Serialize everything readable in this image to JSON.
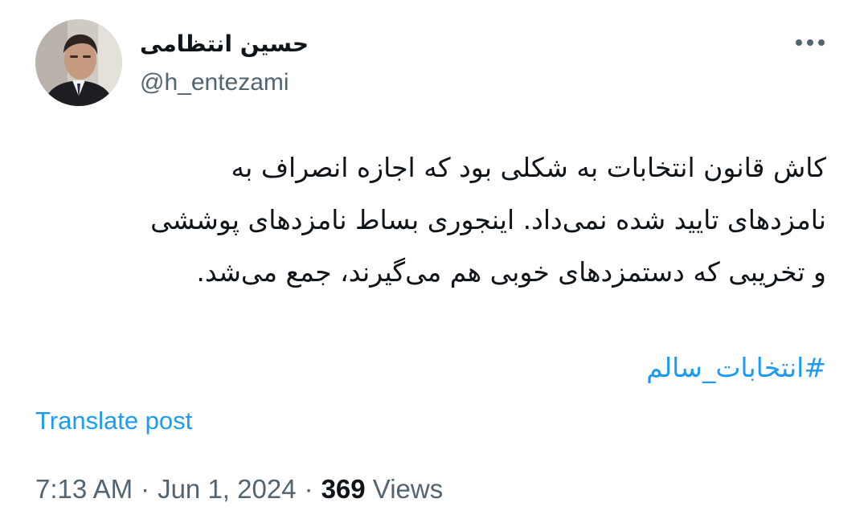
{
  "author": {
    "display_name": "حسین انتظامی",
    "handle": "@h_entezami"
  },
  "post": {
    "text_lines": [
      "کاش قانون انتخابات به شکلی بود که اجازه انصراف به",
      "نامزدهای تایید شده نمی‌داد. اینجوری بساط نامزدهای پوششی",
      "و تخریبی که دستمزدهای خوبی هم می‌گیرند، جمع می‌شد."
    ],
    "hashtag": "#انتخابات_سالم",
    "translate_label": "Translate post"
  },
  "meta": {
    "time": "7:13 AM",
    "separator": "·",
    "date": "Jun 1, 2024",
    "views_count": "369",
    "views_label": "Views"
  },
  "icons": {
    "more": "more-horizontal-icon"
  },
  "colors": {
    "link": "#1d9bf0",
    "secondary_text": "#536471",
    "primary_text": "#0f1419",
    "background": "#ffffff"
  }
}
